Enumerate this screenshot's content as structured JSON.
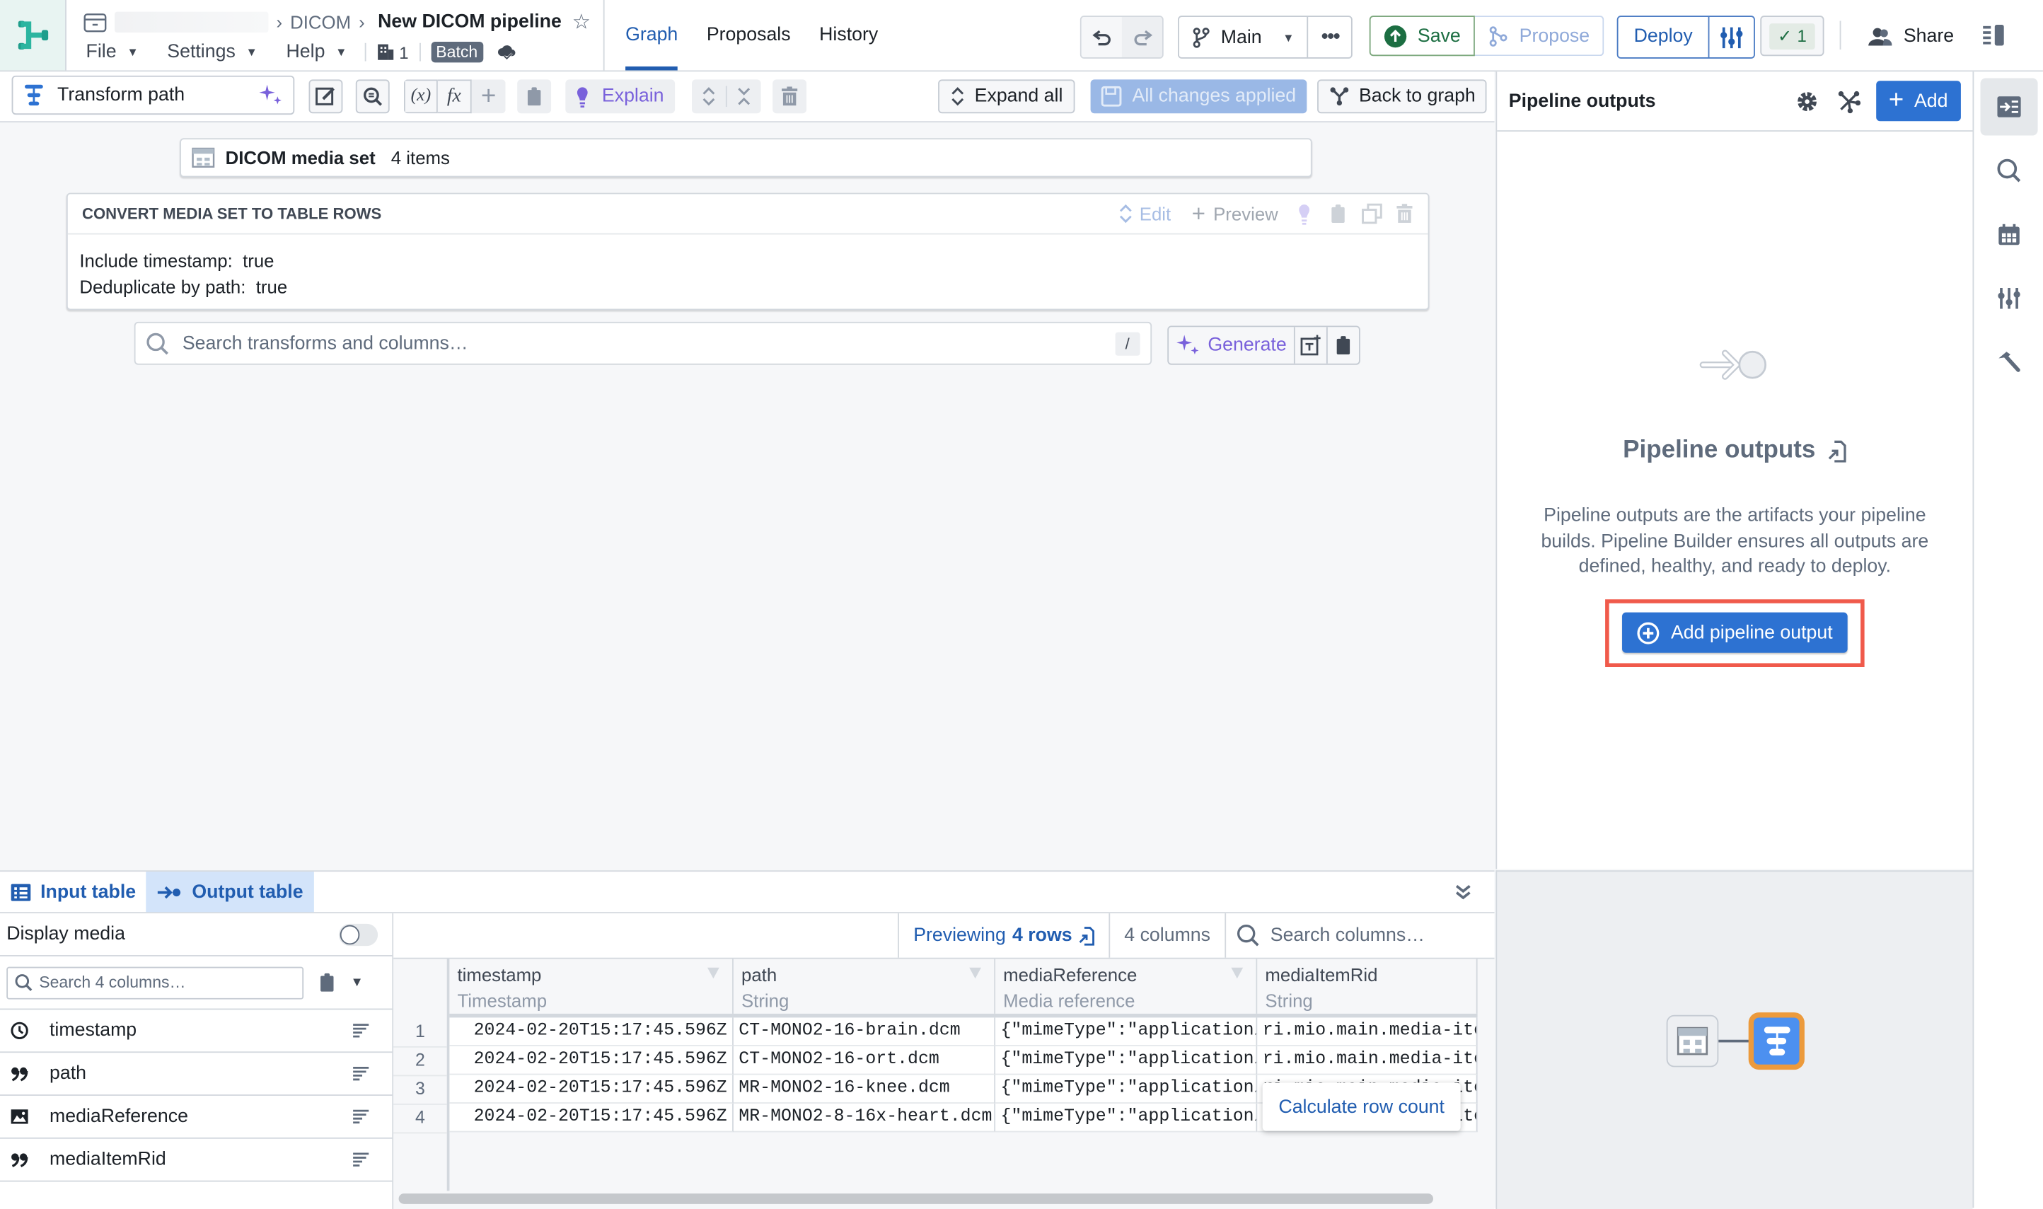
{
  "header": {
    "breadcrumb": [
      "DICOM"
    ],
    "title": "New DICOM pipeline",
    "menus": [
      {
        "label": "File"
      },
      {
        "label": "Settings"
      },
      {
        "label": "Help"
      }
    ],
    "org_count": "1",
    "mode_badge": "Batch",
    "nav_tabs": [
      {
        "label": "Graph",
        "active": true
      },
      {
        "label": "Proposals",
        "active": false
      },
      {
        "label": "History",
        "active": false
      }
    ],
    "branch": "Main",
    "save_label": "Save",
    "propose_label": "Propose",
    "deploy_label": "Deploy",
    "checks_count": "1",
    "share_label": "Share"
  },
  "toolbar": {
    "transform_path_label": "Transform path",
    "explain_label": "Explain",
    "expand_all_label": "Expand all",
    "all_changes_label": "All changes applied",
    "back_to_graph_label": "Back to graph"
  },
  "canvas": {
    "input_node": {
      "name": "DICOM media set",
      "count": "4 items"
    },
    "transform": {
      "title": "CONVERT MEDIA SET TO TABLE ROWS",
      "actions": {
        "edit": "Edit",
        "preview": "Preview"
      },
      "params": [
        {
          "label": "Include timestamp:",
          "value": "true"
        },
        {
          "label": "Deduplicate by path:",
          "value": "true"
        }
      ]
    },
    "search": {
      "placeholder": "Search transforms and columns…",
      "shortcut": "/"
    },
    "generate_label": "Generate"
  },
  "right_panel": {
    "title": "Pipeline outputs",
    "add_label": "Add",
    "empty_title": "Pipeline outputs",
    "empty_description": "Pipeline outputs are the artifacts your pipeline builds. Pipeline Builder ensures all outputs are defined, healthy, and ready to deploy.",
    "add_output_label": "Add pipeline output",
    "highlight_color": "#f05a4b"
  },
  "bottom": {
    "tabs": [
      {
        "label": "Input table",
        "active": false
      },
      {
        "label": "Output table",
        "active": true
      }
    ],
    "display_media_label": "Display media",
    "display_media_on": false,
    "column_search_placeholder": "Search 4 columns…",
    "columns": [
      {
        "name": "timestamp",
        "icon": "clock-icon"
      },
      {
        "name": "path",
        "icon": "quote-icon"
      },
      {
        "name": "mediaReference",
        "icon": "image-icon"
      },
      {
        "name": "mediaItemRid",
        "icon": "quote-icon"
      }
    ],
    "previewing_prefix": "Previewing",
    "previewing_rows": "4 rows",
    "columns_count": "4 columns",
    "table_search_placeholder": "Search columns…",
    "table": {
      "headers": [
        {
          "name": "timestamp",
          "type": "Timestamp"
        },
        {
          "name": "path",
          "type": "String"
        },
        {
          "name": "mediaReference",
          "type": "Media reference"
        },
        {
          "name": "mediaItemRid",
          "type": "String"
        }
      ],
      "rows": [
        {
          "n": "1",
          "cells": [
            "2024-02-20T15:17:45.596Z",
            "CT-MONO2-16-brain.dcm",
            "{\"mimeType\":\"application/",
            "ri.mio.main.media-ite"
          ]
        },
        {
          "n": "2",
          "cells": [
            "2024-02-20T15:17:45.596Z",
            "CT-MONO2-16-ort.dcm",
            "{\"mimeType\":\"application/",
            "ri.mio.main.media-ite"
          ]
        },
        {
          "n": "3",
          "cells": [
            "2024-02-20T15:17:45.596Z",
            "MR-MONO2-16-knee.dcm",
            "{\"mimeType\":\"application/",
            "ri.mio.main.media-ite"
          ]
        },
        {
          "n": "4",
          "cells": [
            "2024-02-20T15:17:45.596Z",
            "MR-MONO2-8-16x-heart.dcm",
            "{\"mimeType\":\"application/",
            "ri.mio.main.media-ite"
          ]
        }
      ]
    },
    "calc_row_count_label": "Calculate row count"
  }
}
